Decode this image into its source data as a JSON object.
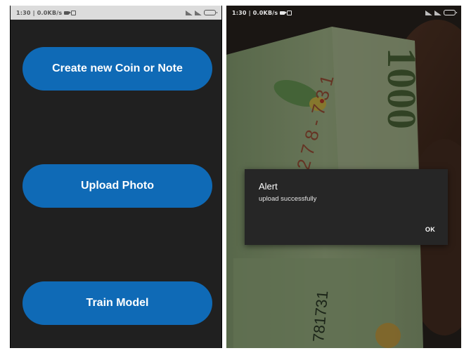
{
  "left_screen": {
    "status_bar": {
      "time_and_speed": "1:30 | 0.0KB/s"
    },
    "buttons": {
      "create": "Create new Coin or Note",
      "upload": "Upload Photo",
      "train": "Train Model"
    },
    "colors": {
      "button": "#0f6ab6",
      "background": "#202020"
    }
  },
  "right_screen": {
    "status_bar": {
      "time_and_speed": "1:30 | 0.0KB/s"
    },
    "banknote": {
      "denomination": "1000",
      "serial": "781731"
    },
    "alert": {
      "title": "Alert",
      "message": "upload successfully",
      "ok_label": "OK"
    }
  }
}
